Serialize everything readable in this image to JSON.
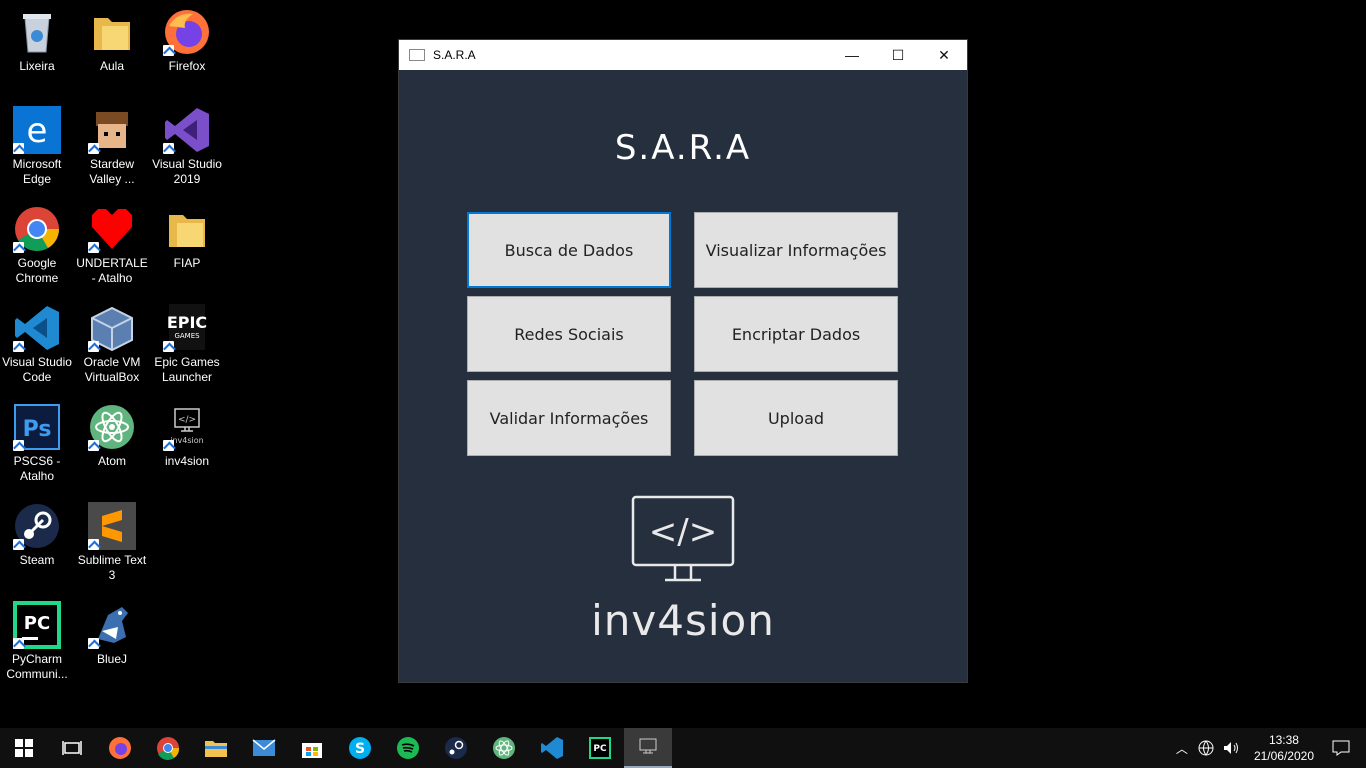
{
  "desktop": {
    "icons": [
      {
        "label": "Lixeira"
      },
      {
        "label": "Aula"
      },
      {
        "label": "Firefox"
      },
      {
        "label": "Microsoft Edge"
      },
      {
        "label": "Stardew Valley ..."
      },
      {
        "label": "Visual Studio 2019"
      },
      {
        "label": "Google Chrome"
      },
      {
        "label": "UNDERTALE - Atalho"
      },
      {
        "label": "FIAP"
      },
      {
        "label": "Visual Studio Code"
      },
      {
        "label": "Oracle VM VirtualBox"
      },
      {
        "label": "Epic Games Launcher"
      },
      {
        "label": "PSCS6 - Atalho"
      },
      {
        "label": "Atom"
      },
      {
        "label": "inv4sion"
      },
      {
        "label": "Steam"
      },
      {
        "label": "Sublime Text 3"
      },
      {
        "label": "PyCharm Communi..."
      },
      {
        "label": "BlueJ"
      }
    ],
    "epic_text": "EPIC",
    "epic_sub": "GAMES",
    "ps_text": "Ps",
    "pc_text": "PC"
  },
  "window": {
    "title": "S.A.R.A",
    "minimize": "—",
    "maximize": "☐",
    "close": "✕",
    "heading": "S.A.R.A",
    "buttons": [
      {
        "label": "Busca de Dados"
      },
      {
        "label": "Visualizar Informações"
      },
      {
        "label": "Redes Sociais"
      },
      {
        "label": "Encriptar Dados"
      },
      {
        "label": "Validar Informações"
      },
      {
        "label": "Upload"
      }
    ],
    "logo_symbol": "</>",
    "logo_text": "inv4sion"
  },
  "taskbar": {
    "time": "13:38",
    "date": "21/06/2020",
    "apps": [
      "start-icon",
      "task-view-icon",
      "firefox-icon",
      "chrome-icon",
      "file-explorer-icon",
      "mail-icon",
      "store-icon",
      "skype-icon",
      "spotify-icon",
      "steam-icon",
      "atom-icon",
      "vscode-icon",
      "pycharm-icon",
      "sara-app-icon"
    ]
  },
  "colors": {
    "window_bg": "#252f3e",
    "button_bg": "#e1e1e1",
    "focus": "#0078d7"
  }
}
